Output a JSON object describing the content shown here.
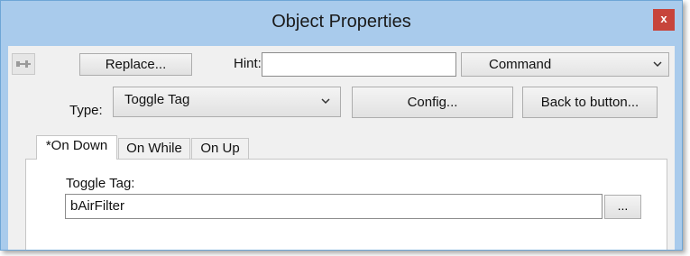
{
  "window": {
    "title": "Object Properties",
    "close_label": "x"
  },
  "toolbar": {
    "pin_icon": "pushpin-icon",
    "replace_label": "Replace...",
    "hint_label": "Hint:",
    "hint_value": "",
    "command_value": "Command"
  },
  "type_row": {
    "type_label": "Type:",
    "type_value": "Toggle Tag",
    "config_label": "Config...",
    "back_label": "Back to button..."
  },
  "tabs": [
    {
      "label": "*On Down",
      "active": true
    },
    {
      "label": "On While",
      "active": false
    },
    {
      "label": "On Up",
      "active": false
    }
  ],
  "panel": {
    "field_label": "Toggle Tag:",
    "field_value": "bAirFilter",
    "browse_label": "..."
  },
  "colors": {
    "titlebar": "#a9cbec",
    "close": "#c7443b",
    "client": "#f0f0f0"
  }
}
